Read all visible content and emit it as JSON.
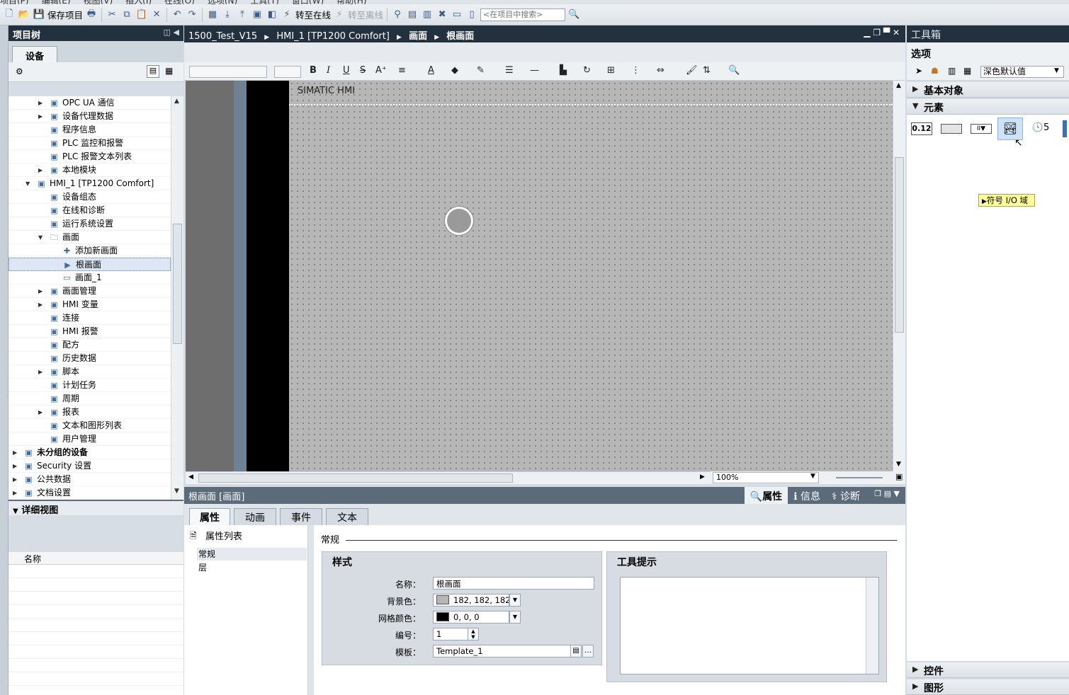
{
  "menubar": [
    "项目(P)",
    "编辑(E)",
    "视图(V)",
    "插入(I)",
    "在线(O)",
    "选项(N)",
    "工具(T)",
    "窗口(W)",
    "帮助(H)"
  ],
  "toolbar": {
    "save_label": "保存项目",
    "go_online": "转至在线",
    "go_offline": "转至离线",
    "search_placeholder": "<在项目中搜索>"
  },
  "project_tree": {
    "title": "项目树",
    "tab": "设备",
    "items": [
      {
        "label": "OPC UA 通信",
        "icon": "opc-ua-icon",
        "indent": 2,
        "arrow": "right",
        "bold": false,
        "selected": false
      },
      {
        "label": "设备代理数据",
        "icon": "proxy-data-icon",
        "indent": 2,
        "arrow": "right",
        "bold": false,
        "selected": false
      },
      {
        "label": "程序信息",
        "icon": "program-info-icon",
        "indent": 2,
        "arrow": "",
        "bold": false,
        "selected": false
      },
      {
        "label": "PLC 监控和报警",
        "icon": "plc-alarm-icon",
        "indent": 2,
        "arrow": "",
        "bold": false,
        "selected": false
      },
      {
        "label": "PLC 报警文本列表",
        "icon": "text-list-icon",
        "indent": 2,
        "arrow": "",
        "bold": false,
        "selected": false
      },
      {
        "label": "本地模块",
        "icon": "local-modules-icon",
        "indent": 2,
        "arrow": "right",
        "bold": false,
        "selected": false
      },
      {
        "label": "HMI_1 [TP1200 Comfort]",
        "icon": "hmi-device-icon",
        "indent": 1,
        "arrow": "down",
        "bold": false,
        "selected": false
      },
      {
        "label": "设备组态",
        "icon": "device-config-icon",
        "indent": 2,
        "arrow": "",
        "bold": false,
        "selected": false
      },
      {
        "label": "在线和诊断",
        "icon": "online-diagnostics-icon",
        "indent": 2,
        "arrow": "",
        "bold": false,
        "selected": false
      },
      {
        "label": "运行系统设置",
        "icon": "runtime-settings-icon",
        "indent": 2,
        "arrow": "",
        "bold": false,
        "selected": false
      },
      {
        "label": "画面",
        "icon": "folder-icon",
        "indent": 2,
        "arrow": "down",
        "bold": false,
        "selected": false
      },
      {
        "label": "添加新画面",
        "icon": "add-screen-icon",
        "indent": 3,
        "arrow": "",
        "bold": false,
        "selected": false
      },
      {
        "label": "根画面",
        "icon": "root-screen-icon",
        "indent": 3,
        "arrow": "",
        "bold": false,
        "selected": true
      },
      {
        "label": "画面_1",
        "icon": "screen-icon",
        "indent": 3,
        "arrow": "",
        "bold": false,
        "selected": false
      },
      {
        "label": "画面管理",
        "icon": "screen-management-icon",
        "indent": 2,
        "arrow": "right",
        "bold": false,
        "selected": false
      },
      {
        "label": "HMI 变量",
        "icon": "hmi-tags-icon",
        "indent": 2,
        "arrow": "right",
        "bold": false,
        "selected": false
      },
      {
        "label": "连接",
        "icon": "connections-icon",
        "indent": 2,
        "arrow": "",
        "bold": false,
        "selected": false
      },
      {
        "label": "HMI 报警",
        "icon": "hmi-alarms-icon",
        "indent": 2,
        "arrow": "",
        "bold": false,
        "selected": false
      },
      {
        "label": "配方",
        "icon": "recipes-icon",
        "indent": 2,
        "arrow": "",
        "bold": false,
        "selected": false
      },
      {
        "label": "历史数据",
        "icon": "historical-data-icon",
        "indent": 2,
        "arrow": "",
        "bold": false,
        "selected": false
      },
      {
        "label": "脚本",
        "icon": "scripts-icon",
        "indent": 2,
        "arrow": "right",
        "bold": false,
        "selected": false
      },
      {
        "label": "计划任务",
        "icon": "scheduled-tasks-icon",
        "indent": 2,
        "arrow": "",
        "bold": false,
        "selected": false
      },
      {
        "label": "周期",
        "icon": "cycles-icon",
        "indent": 2,
        "arrow": "",
        "bold": false,
        "selected": false
      },
      {
        "label": "报表",
        "icon": "reports-icon",
        "indent": 2,
        "arrow": "right",
        "bold": false,
        "selected": false
      },
      {
        "label": "文本和图形列表",
        "icon": "text-graphic-lists-icon",
        "indent": 2,
        "arrow": "",
        "bold": false,
        "selected": false
      },
      {
        "label": "用户管理",
        "icon": "user-admin-icon",
        "indent": 2,
        "arrow": "",
        "bold": false,
        "selected": false
      },
      {
        "label": "未分组的设备",
        "icon": "ungrouped-devices-icon",
        "indent": 0,
        "arrow": "right",
        "bold": true,
        "selected": false
      },
      {
        "label": "Security 设置",
        "icon": "security-settings-icon",
        "indent": 0,
        "arrow": "right",
        "bold": false,
        "selected": false
      },
      {
        "label": "公共数据",
        "icon": "common-data-icon",
        "indent": 0,
        "arrow": "right",
        "bold": false,
        "selected": false
      },
      {
        "label": "文档设置",
        "icon": "documentation-settings-icon",
        "indent": 0,
        "arrow": "right",
        "bold": false,
        "selected": false
      }
    ]
  },
  "details_view": {
    "title": "详细视图",
    "column": "名称"
  },
  "editor": {
    "breadcrumb": [
      "1500_Test_V15",
      "HMI_1 [TP1200 Comfort]",
      "画面",
      "根画面"
    ],
    "zoom": "100%",
    "canvas_title": "SIMATIC HMI"
  },
  "inspector": {
    "title": "根画面 [画面]",
    "right_tabs": [
      "属性",
      "信息",
      "诊断"
    ],
    "tabs": [
      "属性",
      "动画",
      "事件",
      "文本"
    ],
    "property_list_title": "属性列表",
    "nav_items": [
      "常规",
      "层"
    ],
    "section_title": "常规",
    "style_group": "样式",
    "tooltip_group": "工具提示",
    "fields": {
      "name_label": "名称",
      "name_value": "根画面",
      "bg_label": "背景色",
      "bg_value": "182, 182, 182",
      "bg_color": "#b6b6b6",
      "grid_label": "网格颜色",
      "grid_value": "0, 0, 0",
      "grid_color": "#000000",
      "number_label": "编号",
      "number_value": "1",
      "template_label": "模板",
      "template_value": "Template_1"
    }
  },
  "toolbox": {
    "title": "工具箱",
    "options_label": "选项",
    "style_select": "深色默认值",
    "sections": [
      "基本对象",
      "元素",
      "控件",
      "图形"
    ],
    "element_tooltip": "符号 I/O 域",
    "io_field_text": "0.12",
    "clock_digit": "5"
  },
  "colors": {
    "title_bar": "#23303d",
    "canvas_bg": "#b6b6b6",
    "tooltip_bg": "#ffff99"
  }
}
